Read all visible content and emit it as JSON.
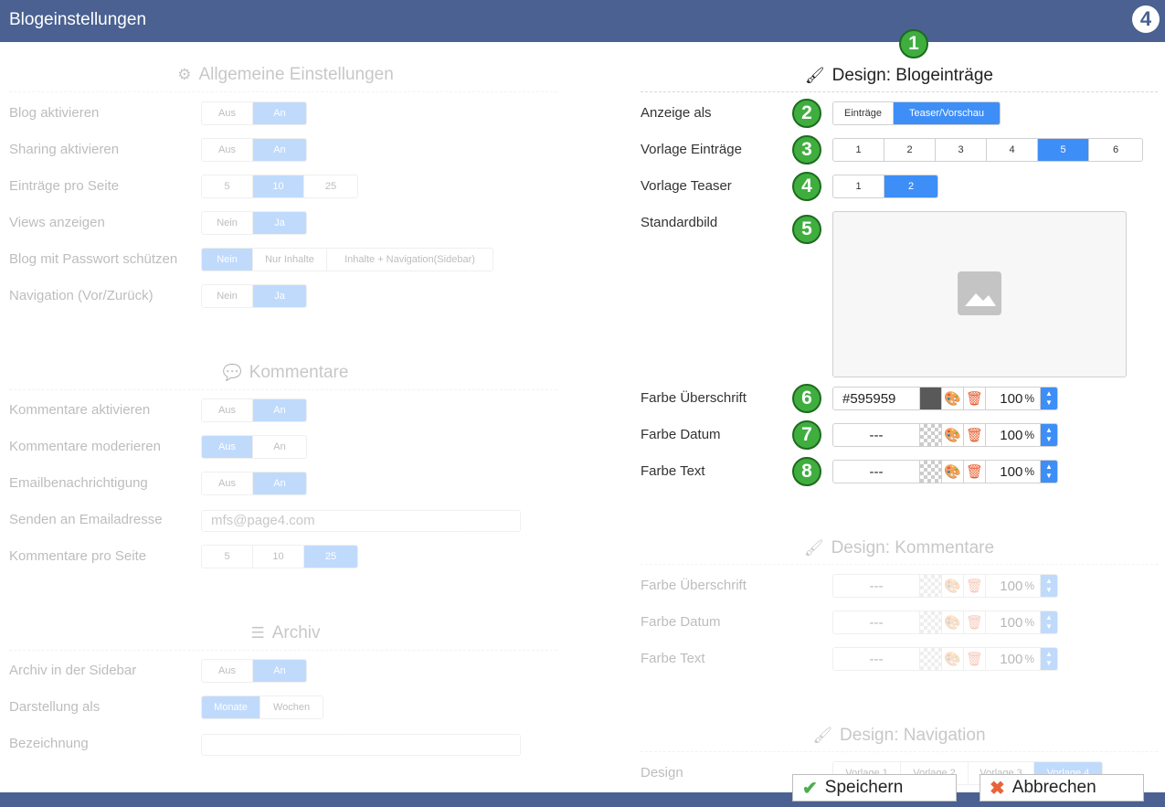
{
  "window": {
    "title": "Blogeinstellungen",
    "logo_text": "4"
  },
  "general": {
    "heading": "Allgemeine Einstellungen",
    "rows": [
      {
        "label": "Blog aktivieren",
        "options": [
          "Aus",
          "An"
        ],
        "selected": "An"
      },
      {
        "label": "Sharing aktivieren",
        "options": [
          "Aus",
          "An"
        ],
        "selected": "An"
      },
      {
        "label": "Einträge pro Seite",
        "options": [
          "5",
          "10",
          "25"
        ],
        "selected": "10"
      },
      {
        "label": "Views anzeigen",
        "options": [
          "Nein",
          "Ja"
        ],
        "selected": "Ja"
      },
      {
        "label": "Blog mit Passwort schützen",
        "options": [
          "Nein",
          "Nur Inhalte",
          "Inhalte + Navigation(Sidebar)"
        ],
        "selected": "Nein"
      },
      {
        "label": "Navigation (Vor/Zurück)",
        "options": [
          "Nein",
          "Ja"
        ],
        "selected": "Ja"
      }
    ]
  },
  "comments": {
    "heading": "Kommentare",
    "rows": [
      {
        "label": "Kommentare aktivieren",
        "options": [
          "Aus",
          "An"
        ],
        "selected": "An"
      },
      {
        "label": "Kommentare moderieren",
        "options": [
          "Aus",
          "An"
        ],
        "selected": "Aus"
      },
      {
        "label": "Emailbenachrichtigung",
        "options": [
          "Aus",
          "An"
        ],
        "selected": "An"
      },
      {
        "label": "Senden an Emailadresse",
        "value": "mfs@page4.com"
      },
      {
        "label": "Kommentare pro Seite",
        "options": [
          "5",
          "10",
          "25"
        ],
        "selected": "25"
      }
    ]
  },
  "archive": {
    "heading": "Archiv",
    "rows": [
      {
        "label": "Archiv in der Sidebar",
        "options": [
          "Aus",
          "An"
        ],
        "selected": "An"
      },
      {
        "label": "Darstellung als",
        "options": [
          "Monate",
          "Wochen"
        ],
        "selected": "Monate"
      },
      {
        "label": "Bezeichnung",
        "value": ""
      }
    ]
  },
  "design_entries": {
    "heading": "Design: Blogeinträge",
    "display_as": {
      "label": "Anzeige als",
      "options": [
        "Einträge",
        "Teaser/Vorschau"
      ],
      "selected": "Teaser/Vorschau"
    },
    "template_entries": {
      "label": "Vorlage Einträge",
      "options": [
        "1",
        "2",
        "3",
        "4",
        "5",
        "6"
      ],
      "selected": "5"
    },
    "template_teaser": {
      "label": "Vorlage Teaser",
      "options": [
        "1",
        "2"
      ],
      "selected": "2"
    },
    "default_image": {
      "label": "Standardbild"
    },
    "color_heading": {
      "label": "Farbe Überschrift",
      "value": "#595959",
      "percent": "100",
      "unit": "%"
    },
    "color_date": {
      "label": "Farbe Datum",
      "value": "---",
      "percent": "100",
      "unit": "%"
    },
    "color_text": {
      "label": "Farbe Text",
      "value": "---",
      "percent": "100",
      "unit": "%"
    }
  },
  "design_comments": {
    "heading": "Design: Kommentare",
    "color_heading": {
      "label": "Farbe Überschrift",
      "value": "---",
      "percent": "100",
      "unit": "%"
    },
    "color_date": {
      "label": "Farbe Datum",
      "value": "---",
      "percent": "100",
      "unit": "%"
    },
    "color_text": {
      "label": "Farbe Text",
      "value": "---",
      "percent": "100",
      "unit": "%"
    }
  },
  "design_navigation": {
    "heading": "Design: Navigation",
    "design": {
      "label": "Design",
      "options": [
        "Vorlage 1",
        "Vorlage 2",
        "Vorlage 3",
        "Vorlage 4"
      ],
      "selected": "Vorlage 4"
    }
  },
  "badges": [
    "1",
    "2",
    "3",
    "4",
    "5",
    "6",
    "7",
    "8"
  ],
  "buttons": {
    "save": "Speichern",
    "cancel": "Abbrechen"
  },
  "colors": {
    "header": "#4a6191",
    "accent": "#3e8ef7",
    "badge": "#3fae3f"
  }
}
